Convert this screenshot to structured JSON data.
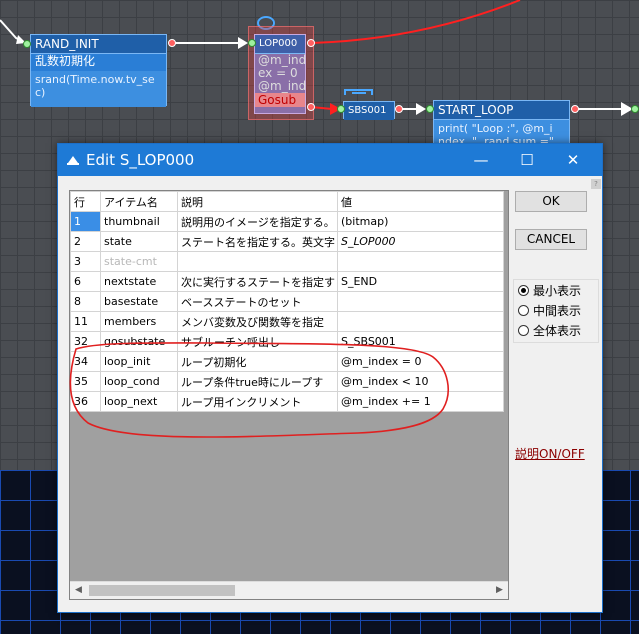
{
  "nodes": {
    "rand_init": {
      "title": "RAND_INIT",
      "subtitle": "乱数初期化",
      "body": [
        "srand(Time.now.tv_se",
        "c)"
      ]
    },
    "lop000": {
      "title": "LOP000",
      "body": [
        "@m_ind",
        "ex = 0",
        "@m_ind"
      ],
      "gosub": "Gosub"
    },
    "sbs001": {
      "title": "SBS001"
    },
    "start_loop": {
      "title": "START_LOOP",
      "body": [
        "print( \"Loop :\", @m_i",
        "ndex, \", rand sum =\""
      ]
    }
  },
  "dialog": {
    "title": "Edit S_LOP000",
    "window_buttons": {
      "minimize": "—",
      "maximize": "☐",
      "close": "✕"
    },
    "columns": [
      "行",
      "アイテム名",
      "説明",
      "値"
    ],
    "rows": [
      {
        "no": "1",
        "name": "thumbnail",
        "desc": "説明用のイメージを指定する。",
        "value": "(bitmap)"
      },
      {
        "no": "2",
        "name": "state",
        "desc": "ステート名を指定する。英文字",
        "value": "S_LOP000"
      },
      {
        "no": "3",
        "name": "state-cmt",
        "desc": "",
        "value": ""
      },
      {
        "no": "6",
        "name": "nextstate",
        "desc": "次に実行するステートを指定す",
        "value": "S_END"
      },
      {
        "no": "8",
        "name": "basestate",
        "desc": "ベースステートのセット",
        "value": ""
      },
      {
        "no": "11",
        "name": "members",
        "desc": "メンバ変数及び関数等を指定",
        "value": ""
      },
      {
        "no": "32",
        "name": "gosubstate",
        "desc": "サブルーチン呼出し",
        "value": "S_SBS001"
      },
      {
        "no": "34",
        "name": "loop_init",
        "desc": "ループ初期化",
        "value": "@m_index = 0"
      },
      {
        "no": "35",
        "name": "loop_cond",
        "desc": "ループ条件true時にループす",
        "value": "@m_index < 10"
      },
      {
        "no": "36",
        "name": "loop_next",
        "desc": "ループ用インクリメント",
        "value": "@m_index += 1"
      }
    ],
    "ok_label": "OK",
    "cancel_label": "CANCEL",
    "view_options": [
      "最小表示",
      "中間表示",
      "全体表示"
    ],
    "selected_view": "最小表示",
    "toggle_desc_label": "説明ON/OFF"
  },
  "colors": {
    "node_blue": "#2a7ed6",
    "wire_red": "#ff2020",
    "selection": "#3a8ee6",
    "titlebar": "#1e7ad6",
    "annotation": "#e02020"
  }
}
